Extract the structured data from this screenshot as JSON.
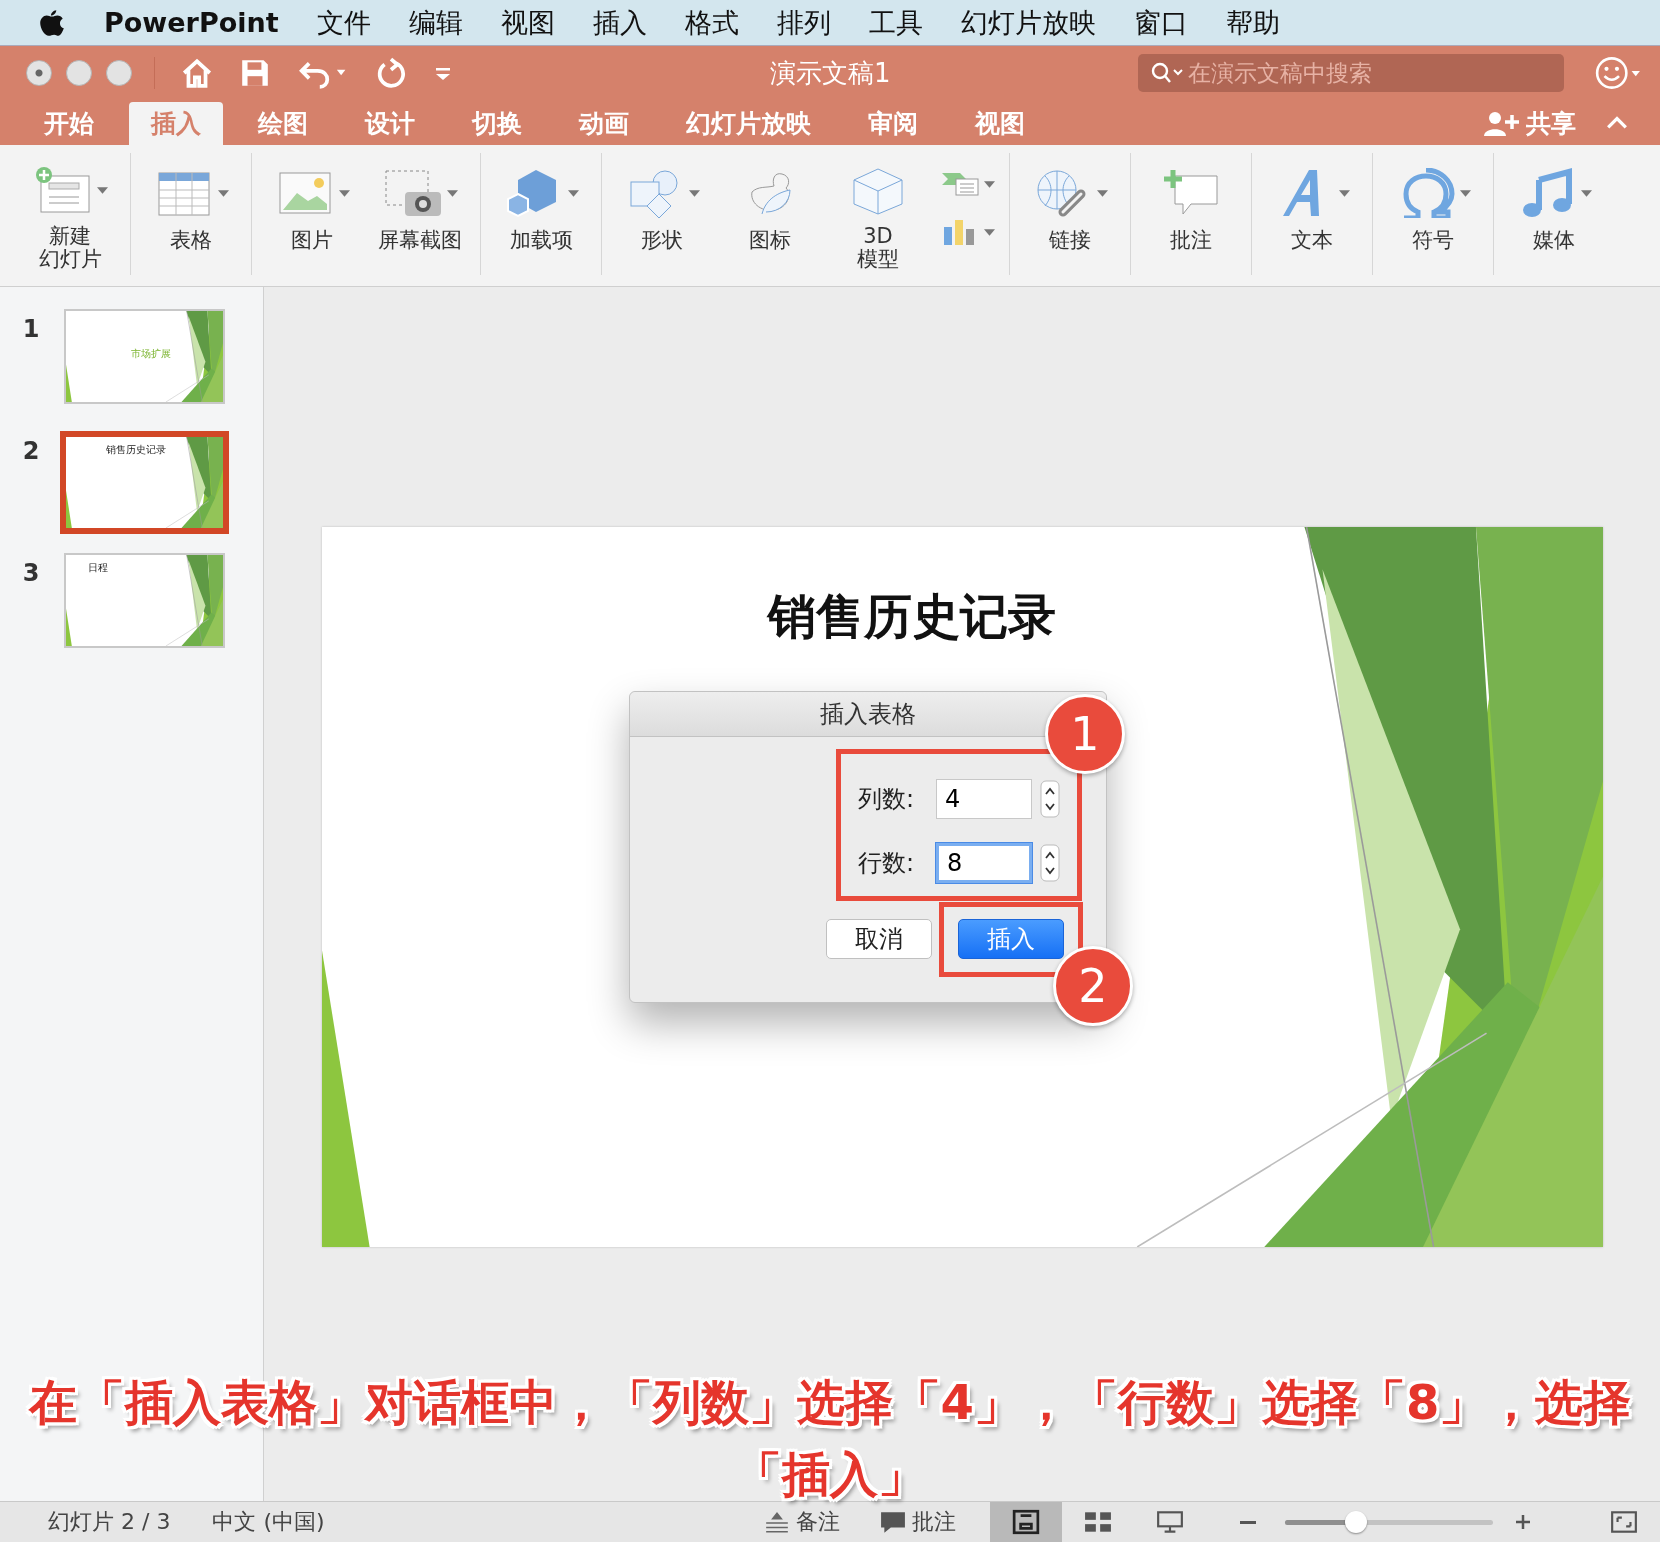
{
  "menu_bar": {
    "app_name": "PowerPoint",
    "items": [
      "文件",
      "编辑",
      "视图",
      "插入",
      "格式",
      "排列",
      "工具",
      "幻灯片放映",
      "窗口",
      "帮助"
    ]
  },
  "title_bar": {
    "title": "演示文稿1",
    "search": {
      "placeholder": "在演示文稿中搜索"
    }
  },
  "ribbon_tabs": [
    {
      "label": "开始",
      "selected": false
    },
    {
      "label": "插入",
      "selected": true
    },
    {
      "label": "绘图",
      "selected": false
    },
    {
      "label": "设计",
      "selected": false
    },
    {
      "label": "切换",
      "selected": false
    },
    {
      "label": "动画",
      "selected": false
    },
    {
      "label": "幻灯片放映",
      "selected": false
    },
    {
      "label": "审阅",
      "selected": false
    },
    {
      "label": "视图",
      "selected": false
    }
  ],
  "share": "共享",
  "ribbon_groups": [
    {
      "items": [
        {
          "kind": "new_slide",
          "label": [
            "新建",
            "幻灯片"
          ],
          "dropdown": true
        }
      ]
    },
    {
      "items": [
        {
          "kind": "table",
          "label": "表格",
          "dropdown": true
        }
      ]
    },
    {
      "items": [
        {
          "kind": "picture",
          "label": "图片",
          "dropdown": true
        },
        {
          "kind": "screenshot",
          "label": "屏幕截图",
          "dropdown": true
        }
      ]
    },
    {
      "items": [
        {
          "kind": "addins",
          "label": "加载项",
          "dropdown": true
        }
      ]
    },
    {
      "items": [
        {
          "kind": "shapes",
          "label": "形状",
          "dropdown": true
        },
        {
          "kind": "icons",
          "label": "图标",
          "dropdown": false
        },
        {
          "kind": "model3d",
          "label": [
            "3D",
            "模型"
          ],
          "dropdown": false
        },
        {
          "kind": "stack",
          "dropdown": true
        }
      ]
    },
    {
      "items": [
        {
          "kind": "link",
          "label": "链接",
          "dropdown": true
        }
      ]
    },
    {
      "items": [
        {
          "kind": "comment",
          "label": "批注",
          "dropdown": false
        }
      ]
    },
    {
      "items": [
        {
          "kind": "text",
          "label": "文本",
          "dropdown": true
        }
      ]
    },
    {
      "items": [
        {
          "kind": "symbol",
          "label": "符号",
          "dropdown": true
        }
      ]
    },
    {
      "items": [
        {
          "kind": "media",
          "label": "媒体",
          "dropdown": true
        }
      ]
    }
  ],
  "slides": [
    {
      "number": "1",
      "kind": "title_slide",
      "title": "市场扩展",
      "selected": false
    },
    {
      "number": "2",
      "kind": "content",
      "title": "销售历史记录",
      "selected": true
    },
    {
      "number": "3",
      "kind": "content",
      "title": "日程",
      "selected": false
    }
  ],
  "slide": {
    "title": "销售历史记录"
  },
  "dialog": {
    "title": "插入表格",
    "fields": [
      {
        "label": "列数:",
        "value": "4",
        "focused": false
      },
      {
        "label": "行数:",
        "value": "8",
        "focused": true
      }
    ],
    "buttons": [
      {
        "label": "取消",
        "default": false
      },
      {
        "label": "插入",
        "default": true
      }
    ]
  },
  "callouts": [
    "1",
    "2"
  ],
  "caption": "在「插入表格」对话框中，「列数」选择「4」，「行数」选择「8」，选择「插入」",
  "status_bar": {
    "slide_info": "幻灯片 2 / 3",
    "language": "中文 (中国)",
    "notes": "备注",
    "comments": "批注",
    "views": [
      {
        "kind": "normal",
        "selected": true
      },
      {
        "kind": "sorter",
        "selected": false
      },
      {
        "kind": "reading",
        "selected": false
      }
    ],
    "zoom": {
      "level": 0.31
    }
  }
}
